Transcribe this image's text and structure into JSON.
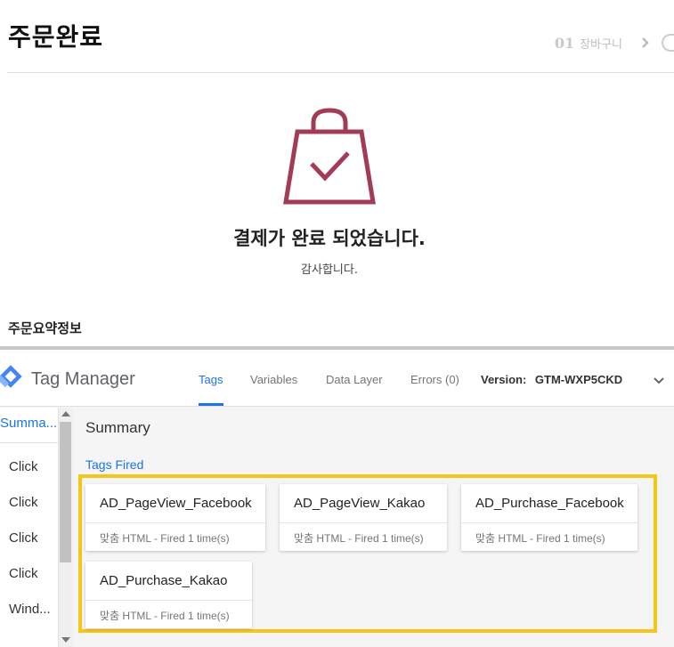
{
  "shop": {
    "page_title": "주문완료",
    "steps": [
      {
        "num": "01",
        "label": "장바구니"
      }
    ],
    "done_title": "결제가 완료 되었습니다.",
    "done_subtitle": "감사합니다.",
    "summary_title": "주문요약정보",
    "accent_color": "#a33b55",
    "icons": {
      "bag": "shopping-bag-check-icon",
      "step_next": "chevron-right-icon"
    }
  },
  "gtm": {
    "brand": "Tag Manager",
    "tabs": [
      {
        "label": "Tags",
        "active": true
      },
      {
        "label": "Variables",
        "active": false
      },
      {
        "label": "Data Layer",
        "active": false
      },
      {
        "label": "Errors (0)",
        "active": false
      }
    ],
    "version_label": "Version:",
    "version_value": "GTM-WXP5CKD",
    "sidebar": [
      {
        "label": "Summa...",
        "active": true
      },
      {
        "label": "Click"
      },
      {
        "label": "Click"
      },
      {
        "label": "Click"
      },
      {
        "label": "Click"
      },
      {
        "label": "Wind..."
      }
    ],
    "summary_title": "Summary",
    "tags_fired_label": "Tags Fired",
    "tags": [
      {
        "name": "AD_PageView_Facebook",
        "status": "맞춤 HTML - Fired 1 time(s)"
      },
      {
        "name": "AD_PageView_Kakao",
        "status": "맞춤 HTML - Fired 1 time(s)"
      },
      {
        "name": "AD_Purchase_Facebook",
        "status": "맞춤 HTML - Fired 1 time(s)"
      },
      {
        "name": "AD_Purchase_Kakao",
        "status": "맞춤 HTML - Fired 1 time(s)"
      }
    ],
    "accent_color": "#1a73e8",
    "highlight_color": "#f5c518"
  }
}
